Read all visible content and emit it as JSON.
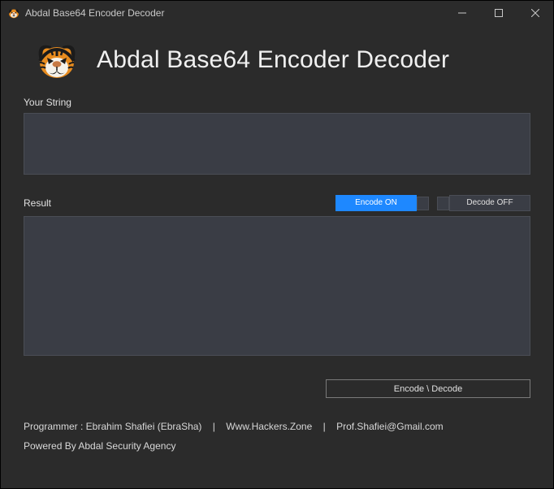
{
  "window": {
    "title": "Abdal Base64 Encoder Decoder"
  },
  "header": {
    "app_title": "Abdal Base64 Encoder Decoder"
  },
  "labels": {
    "your_string": "Your String",
    "result": "Result"
  },
  "inputs": {
    "your_string_value": "",
    "result_value": ""
  },
  "toggles": {
    "encode_label": "Encode ON",
    "decode_label": "Decode OFF"
  },
  "actions": {
    "main_button": "Encode \\ Decode"
  },
  "footer": {
    "programmer_label": "Programmer : Ebrahim Shafiei (EbraSha)",
    "site": "Www.Hackers.Zone",
    "email": "Prof.Shafiei@Gmail.com",
    "powered": "Powered By Abdal Security Agency"
  }
}
